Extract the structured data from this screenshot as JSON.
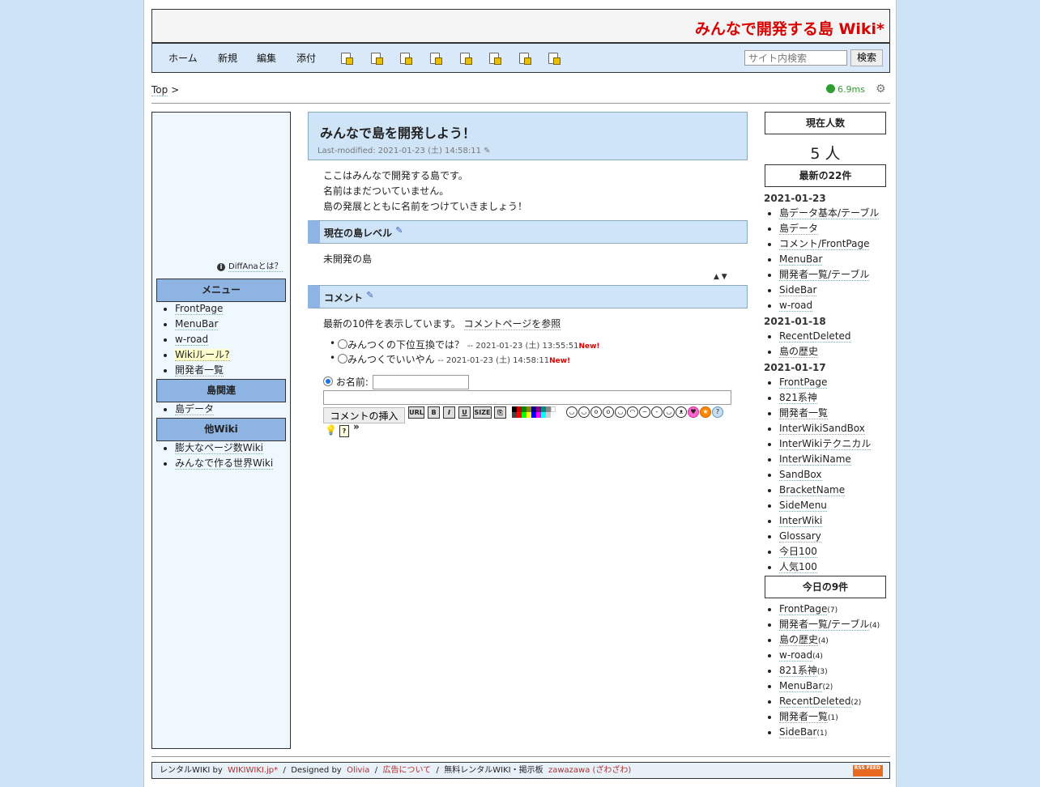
{
  "header": {
    "site_title": "みんなで開発する島 Wiki*"
  },
  "nav": {
    "links": [
      "ホーム",
      "新規",
      "編集",
      "添付"
    ],
    "tool_icons": [
      "list-icon",
      "diff-icon",
      "backup-icon",
      "save-icon",
      "lock-icon",
      "copy-icon",
      "page-icon",
      "help-icon"
    ],
    "search_placeholder": "サイト内検索",
    "search_button": "検索"
  },
  "breadcrumb": {
    "top": "Top",
    "sep": ">"
  },
  "timing": "6.9ms",
  "menubar": {
    "diffana": "DiffAnaとは？",
    "sections": [
      {
        "title": "メニュー",
        "items": [
          "FrontPage",
          "MenuBar",
          "w-road",
          "Wikiルール?",
          "開発者一覧"
        ]
      },
      {
        "title": "島関連",
        "items": [
          "島データ"
        ]
      },
      {
        "title": "他Wiki",
        "items": [
          "膨大なページ数Wiki",
          "みんなで作る世界Wiki"
        ]
      }
    ]
  },
  "content": {
    "title": "みんなで島を開発しよう！",
    "last_modified": "Last-modified: 2021-01-23 (土) 14:58:11",
    "intro": [
      "ここはみんなで開発する島です。",
      "名前はまだついていません。",
      "島の発展とともに名前をつけていきましょう！"
    ],
    "level_heading": "現在の島レベル",
    "level_value": "未開発の島",
    "comment_heading": "コメント",
    "comment_info": "最新の10件を表示しています。",
    "comment_link": "コメントページを参照",
    "comments": [
      {
        "text": "みんつくの下位互換では？",
        "meta": "-- 2021-01-23 (土) 13:55:51",
        "new": "New!"
      },
      {
        "text": "みんつくでいいやん",
        "meta": "-- 2021-01-23 (土) 14:58:11",
        "new": "New!"
      }
    ],
    "name_label": "お名前:",
    "insert_button": "コメントの挿入",
    "format_buttons": [
      "URL",
      "B",
      "I",
      "U",
      "SIZE"
    ],
    "arrows": "▲ ▼"
  },
  "sidebar": {
    "online_title": "現在人数",
    "online_count": "5 人",
    "recent_title": "最新の22件",
    "recent_groups": [
      {
        "date": "2021-01-23",
        "items": [
          "島データ基本/テーブル",
          "島データ",
          "コメント/FrontPage",
          "MenuBar",
          "開発者一覧/テーブル",
          "SideBar",
          "w-road"
        ]
      },
      {
        "date": "2021-01-18",
        "items": [
          "RecentDeleted",
          "島の歴史"
        ]
      },
      {
        "date": "2021-01-17",
        "items": [
          "FrontPage",
          "821系神",
          "開発者一覧",
          "InterWikiSandBox",
          "InterWikiテクニカル",
          "InterWikiName",
          "SandBox",
          "BracketName",
          "SideMenu",
          "InterWiki",
          "Glossary",
          "今日100",
          "人気100"
        ]
      }
    ],
    "today_title": "今日の9件",
    "today_items": [
      {
        "name": "FrontPage",
        "count": "(7)"
      },
      {
        "name": "開発者一覧/テーブル",
        "count": "(4)"
      },
      {
        "name": "島の歴史",
        "count": "(4)"
      },
      {
        "name": "w-road",
        "count": "(4)"
      },
      {
        "name": "821系神",
        "count": "(3)"
      },
      {
        "name": "MenuBar",
        "count": "(2)"
      },
      {
        "name": "RecentDeleted",
        "count": "(2)"
      },
      {
        "name": "開発者一覧",
        "count": "(1)"
      },
      {
        "name": "SideBar",
        "count": "(1)"
      }
    ]
  },
  "footer": {
    "rental": "レンタルWIKI by",
    "wikiwiki": "WIKIWIKI.jp*",
    "designed": "Designed by",
    "olivia": "Olivia",
    "ads": "広告について",
    "free": "無料レンタルWIKI・掲示板",
    "zawazawa": "zawazawa (ざわざわ)",
    "rss": "RSS FEED"
  },
  "colors": {
    "title_red": "#d80000",
    "menu_head": "#8db4e2",
    "heading_bg": "#d0e4f7",
    "new_red": "#dd0000"
  }
}
